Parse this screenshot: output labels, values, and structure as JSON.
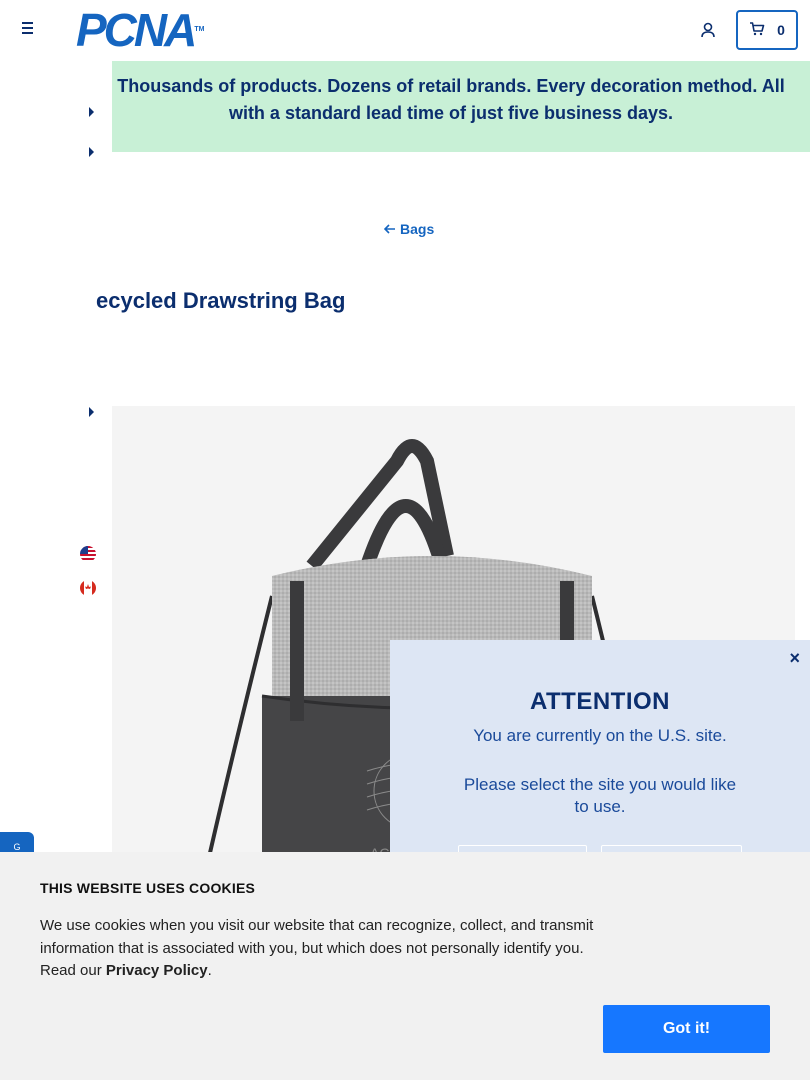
{
  "header": {
    "logo_text": "PCNA",
    "logo_tm": "TM",
    "cart_count": "0"
  },
  "banner": {
    "text": "Thousands of products. Dozens of retail brands. Every decoration method. All with a standard lead time of just five business days."
  },
  "breadcrumb": {
    "back_label": "Bags"
  },
  "product": {
    "title": "ecycled Drawstring Bag"
  },
  "side_tab": {
    "label": "G"
  },
  "attention_modal": {
    "title": "ATTENTION",
    "message": "You are currently on the U.S. site.",
    "prompt": "Please select the site you would like to use.",
    "close_label": "×"
  },
  "cookie_banner": {
    "heading": "THIS WEBSITE USES COOKIES",
    "body": "We use cookies when you visit our website that can recognize, collect, and transmit information that is associated with you, but which does not personally identify you. Read our ",
    "link": "Privacy Policy",
    "period": ".",
    "accept_label": "Got it!"
  },
  "colors": {
    "brand_blue": "#1565c0",
    "navy": "#0b2e6e",
    "banner_green": "#c8f0d6",
    "modal_bg": "#dde6f4",
    "cookie_button": "#1677ff"
  },
  "icons": [
    "menu-icon",
    "user-icon",
    "cart-icon",
    "caret-right-icon",
    "arrow-left-icon",
    "us-flag-icon",
    "canada-flag-icon",
    "close-icon"
  ]
}
